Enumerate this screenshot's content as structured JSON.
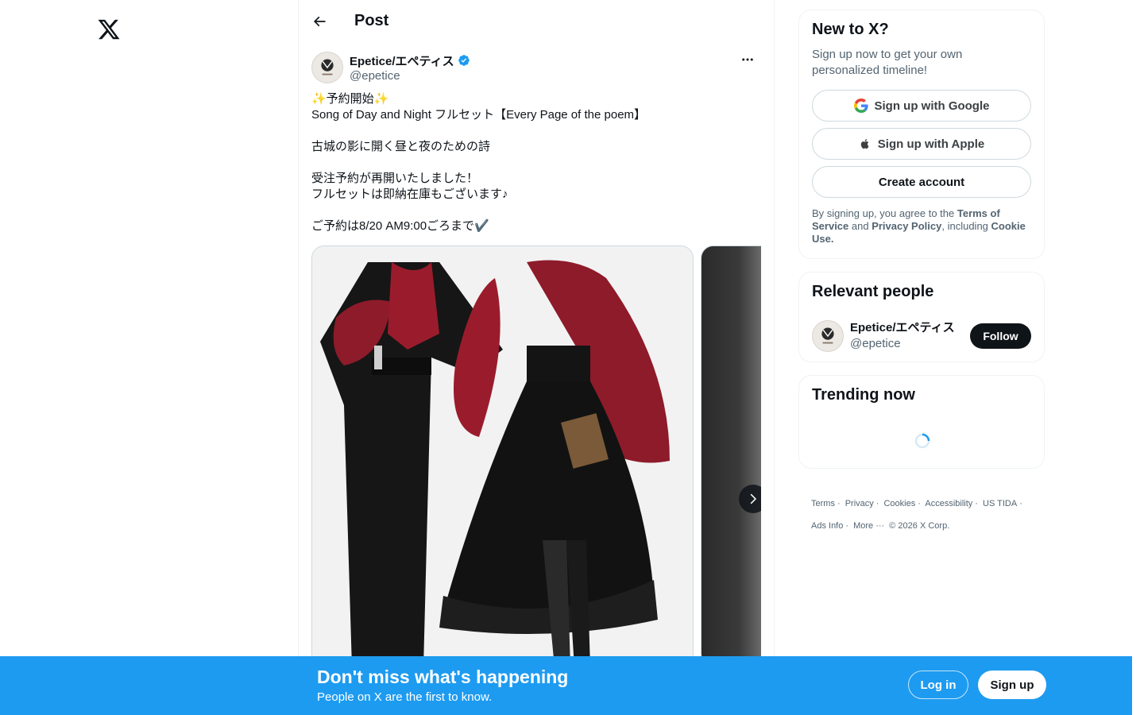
{
  "header": {
    "title": "Post"
  },
  "tweet": {
    "author_name": "Epetice/エペティス",
    "author_handle": "@epetice",
    "lines": [
      "✨予約開始✨",
      "Song of Day and Night フルセット【Every Page of the poem】",
      "",
      "古城の影に開く昼と夜のための詩",
      "",
      "受注予約が再開いたしました！",
      "フルセットは即納在庫もございます♪",
      "",
      "ご予約は8/20 AM9:00ごろまで✔️"
    ],
    "icons": {
      "back": "arrow-left-icon",
      "more": "more-horizontal-icon",
      "verified": "verified-badge-icon",
      "next": "chevron-right-icon"
    }
  },
  "signup_panel": {
    "title": "New to X?",
    "subtitle": "Sign up now to get your own personalized timeline!",
    "google_label": "Sign up with Google",
    "apple_label": "Sign up with Apple",
    "create_label": "Create account",
    "legal": {
      "prefix": "By signing up, you agree to the ",
      "terms": "Terms of Service",
      "and": " and ",
      "privacy": "Privacy Policy",
      "including": ", including ",
      "cookie": "Cookie Use",
      "suffix": "."
    }
  },
  "relevant_people": {
    "title": "Relevant people",
    "person": {
      "name": "Epetice/エペティス",
      "handle": "@epetice",
      "follow_label": "Follow"
    }
  },
  "trending": {
    "title": "Trending now"
  },
  "footer": {
    "links": [
      "Terms",
      "Privacy",
      "Cookies",
      "Accessibility",
      "US TIDA",
      "Ads Info",
      "More ···"
    ],
    "copyright": "© 2026 X Corp."
  },
  "banner": {
    "title": "Don't miss what's happening",
    "subtitle": "People on X are the first to know.",
    "login_label": "Log in",
    "signup_label": "Sign up"
  },
  "colors": {
    "accent": "#1d9bf0",
    "text": "#0f1419",
    "muted": "#536471",
    "border": "#eff3f4"
  }
}
